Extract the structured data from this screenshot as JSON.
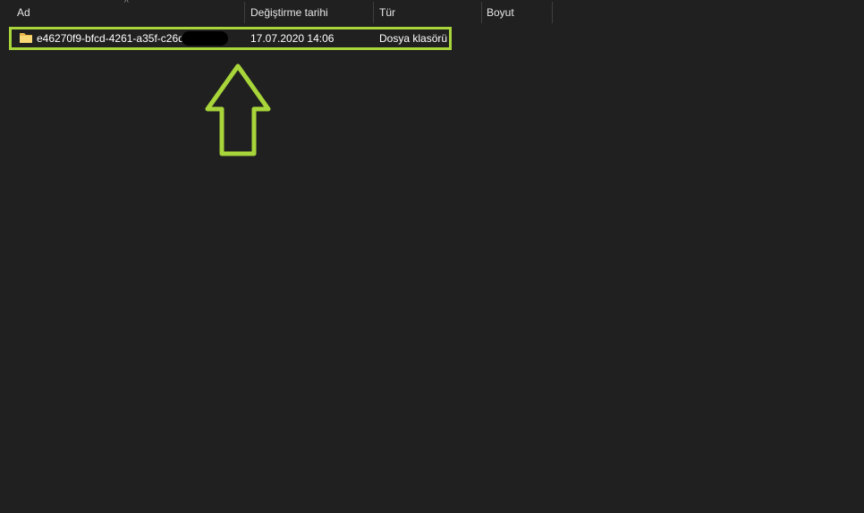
{
  "columns": {
    "name": "Ad",
    "modified": "Değiştirme tarihi",
    "type": "Tür",
    "size": "Boyut"
  },
  "sort_indicator": "^",
  "rows": [
    {
      "name": "e46270f9-bfcd-4261-a35f-c26d",
      "modified": "17.07.2020 14:06",
      "type": "Dosya klasörü",
      "size": "",
      "icon": "folder-icon",
      "highlighted": true
    }
  ],
  "colors": {
    "background": "#202020",
    "highlight": "#a7d53a",
    "folder": "#f8d775"
  },
  "annotation_icon": "up-arrow-icon"
}
